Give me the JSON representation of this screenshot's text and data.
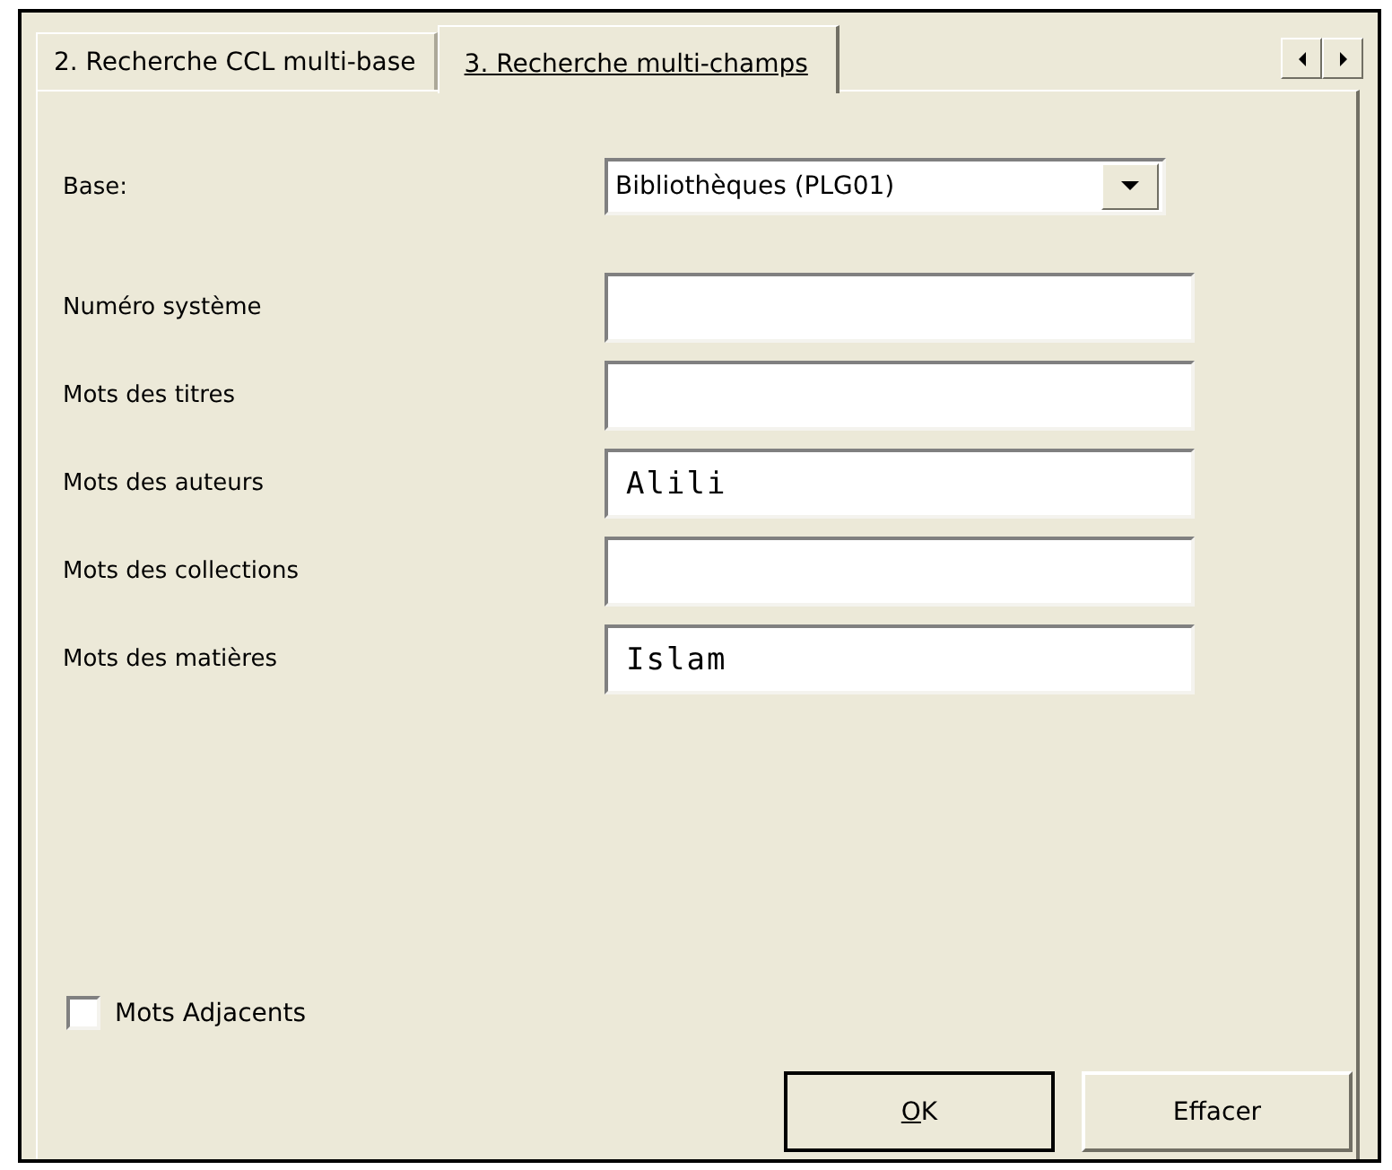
{
  "tabs": [
    {
      "label": "2. Recherche CCL multi-base",
      "selected": false
    },
    {
      "label": "3. Recherche multi-champs",
      "selected": true
    }
  ],
  "base": {
    "label": "Base:",
    "value": "Bibliothèques (PLG01)"
  },
  "fields": [
    {
      "label": "Numéro système"
    },
    {
      "label": "Mots des titres"
    },
    {
      "label": "Mots des auteurs",
      "value": "Alili"
    },
    {
      "label": "Mots des collections"
    },
    {
      "label": "Mots des matières",
      "value": "Islam"
    }
  ],
  "adjacent": {
    "label": "Mots Adjacents",
    "checked": false
  },
  "buttons": [
    {
      "label": "OK",
      "default": true
    },
    {
      "label": "Effacer",
      "default": false
    }
  ]
}
